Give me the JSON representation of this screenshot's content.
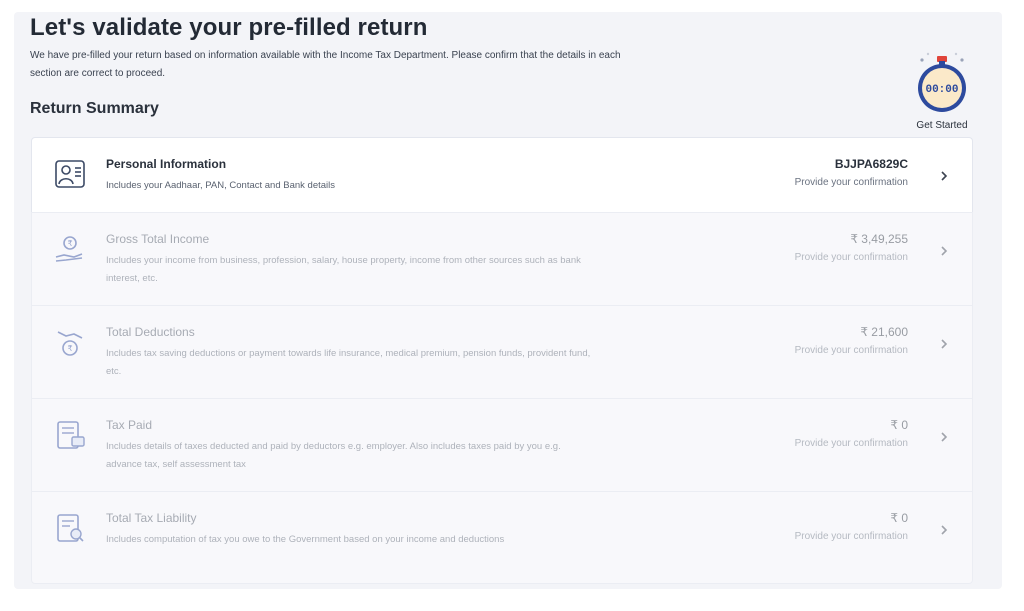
{
  "header": {
    "title": "Let's validate your pre-filled return",
    "subtitle": "We have pre-filled your return based on information available with the Income Tax Department. Please confirm that the details in each section are correct to proceed."
  },
  "section_title": "Return Summary",
  "timer": {
    "display": "00:00",
    "label": "Get Started"
  },
  "cards": [
    {
      "title": "Personal Information",
      "desc": "Includes your Aadhaar, PAN, Contact and Bank details",
      "value": "BJJPA6829C",
      "status": "Provide your confirmation",
      "icon": "personal-id-icon"
    },
    {
      "title": "Gross Total Income",
      "desc": "Includes your income from business, profession, salary, house property, income from other sources such as bank interest, etc.",
      "value": "₹ 3,49,255",
      "status": "Provide your confirmation",
      "icon": "income-hand-icon"
    },
    {
      "title": "Total Deductions",
      "desc": "Includes tax saving deductions or payment towards life insurance, medical premium, pension funds, provident fund, etc.",
      "value": "₹ 21,600",
      "status": "Provide your confirmation",
      "icon": "deductions-icon"
    },
    {
      "title": "Tax Paid",
      "desc": "Includes details of taxes deducted and paid by deductors e.g. employer. Also includes taxes paid by you e.g. advance tax, self assessment tax",
      "value": "₹ 0",
      "status": "Provide your confirmation",
      "icon": "tax-paid-icon"
    },
    {
      "title": "Total Tax Liability",
      "desc": "Includes computation of tax you owe to the Government based on your income and deductions",
      "value": "₹ 0",
      "status": "Provide your confirmation",
      "icon": "tax-liability-icon"
    }
  ],
  "colors": {
    "accent": "#2d4a9e",
    "timer_face": "#fbe9c9",
    "panel_bg": "#f3f4f8"
  }
}
